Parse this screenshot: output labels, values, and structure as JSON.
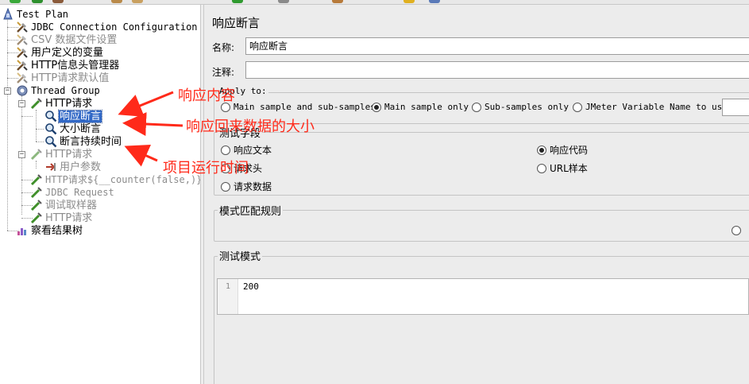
{
  "tree": {
    "items": [
      {
        "label": "Test Plan",
        "icon": "test-plan-icon"
      },
      {
        "label": "JDBC Connection Configuration",
        "icon": "config-wrench-icon"
      },
      {
        "label": "CSV 数据文件设置",
        "icon": "config-wrench-icon"
      },
      {
        "label": "用户定义的变量",
        "icon": "config-wrench-icon"
      },
      {
        "label": "HTTP信息头管理器",
        "icon": "config-wrench-icon"
      },
      {
        "label": "HTTP请求默认值",
        "icon": "config-wrench-icon"
      },
      {
        "label": "Thread Group",
        "icon": "gear-icon"
      },
      {
        "label": "HTTP请求",
        "icon": "sampler-pipette-icon"
      },
      {
        "label": "响应断言",
        "icon": "magnifier-icon"
      },
      {
        "label": "大小断言",
        "icon": "magnifier-icon"
      },
      {
        "label": "断言持续时间",
        "icon": "magnifier-icon"
      },
      {
        "label": "HTTP请求",
        "icon": "sampler-pipette-icon"
      },
      {
        "label": "用户参数",
        "icon": "preprocessor-icon"
      },
      {
        "label": "HTTP请求${__counter(false,)}",
        "icon": "sampler-pipette-icon"
      },
      {
        "label": "JDBC Request",
        "icon": "sampler-pipette-icon"
      },
      {
        "label": "调试取样器",
        "icon": "sampler-pipette-icon"
      },
      {
        "label": "HTTP请求",
        "icon": "sampler-pipette-icon"
      },
      {
        "label": "察看结果树",
        "icon": "listener-chart-icon"
      }
    ]
  },
  "panel": {
    "title": "响应断言",
    "name_label": "名称:",
    "name_value": "响应断言",
    "comment_label": "注释:",
    "comment_value": "",
    "apply_to": {
      "title": "Apply to:",
      "options": [
        "Main sample and sub-samples",
        "Main sample only",
        "Sub-samples only",
        "JMeter Variable Name to use"
      ],
      "selected": "Main sample only"
    },
    "field_to_test": {
      "title": "测试字段",
      "options": [
        "响应文本",
        "响应代码",
        "请求头",
        "URL样本",
        "请求数据"
      ],
      "selected": "响应代码"
    },
    "matching_rules": {
      "title": "模式匹配规则"
    },
    "patterns": {
      "title": "测试模式",
      "lines": [
        {
          "number": "1",
          "text": "200"
        }
      ]
    }
  },
  "annotations": {
    "response_content": "响应内容",
    "response_size": "响应回来数据的大小",
    "run_time": "项目运行时间",
    "color": "#ff2a1a"
  },
  "colors": {
    "selection": "#3168c6",
    "panel_bg": "#ececec"
  }
}
